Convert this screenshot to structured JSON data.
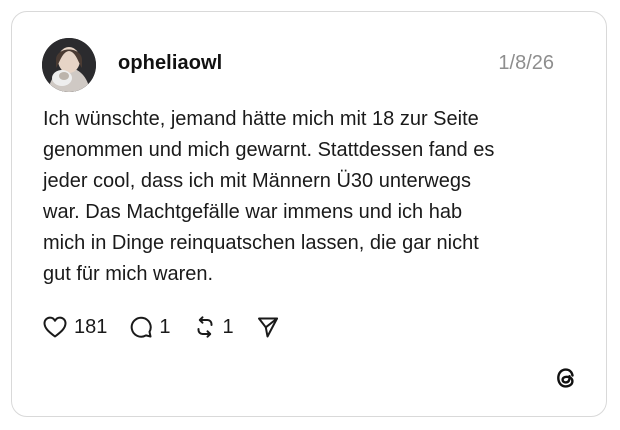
{
  "post": {
    "username": "opheliaowl",
    "date": "1/8/26",
    "text": "Ich wünschte, jemand hätte mich mit 18 zur Seite\ngenommen und mich gewarnt. Stattdessen fand es\njeder cool, dass ich mit Männern Ü30 unterwegs\nwar. Das Machtgefälle war immens und ich hab\nmich in Dinge reinquatschen lassen, die gar nicht\ngut für mich waren."
  },
  "actions": {
    "likes": "181",
    "replies": "1",
    "reposts": "1"
  },
  "icons": {
    "like": "heart-icon",
    "reply": "comment-icon",
    "repost": "repost-icon",
    "share": "send-icon",
    "brand": "threads-logo-icon"
  },
  "colors": {
    "text": "#1a1a1a",
    "muted": "#8e8e8e",
    "border": "#d9d9d9"
  }
}
